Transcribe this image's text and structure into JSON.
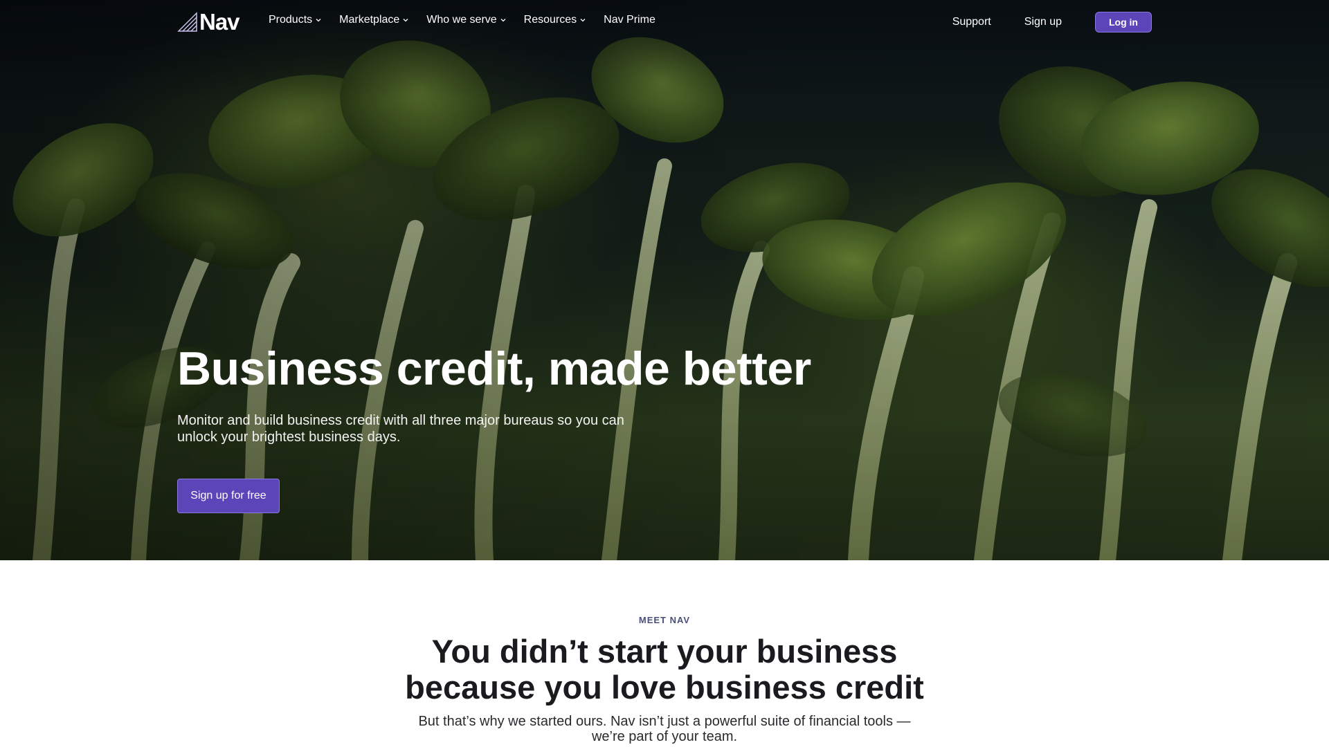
{
  "nav": {
    "logo_text": "Nav",
    "menu": [
      {
        "label": "Products",
        "has_dropdown": true
      },
      {
        "label": "Marketplace",
        "has_dropdown": true
      },
      {
        "label": "Who we serve",
        "has_dropdown": true
      },
      {
        "label": "Resources",
        "has_dropdown": true
      },
      {
        "label": "Nav Prime",
        "has_dropdown": false
      }
    ],
    "support_label": "Support",
    "signup_label": "Sign up",
    "login_label": "Log in"
  },
  "hero": {
    "title": "Business credit, made better",
    "subtitle_line1": "Monitor and build business credit with all three major bureaus so you can",
    "subtitle_line2": "unlock your brightest business days.",
    "cta_label": "Sign up for free",
    "background_image": "seedling-sprouts-photo"
  },
  "meet": {
    "eyebrow": "MEET NAV",
    "title_line1": "You didn’t start your business",
    "title_line2": "because you love business credit",
    "body_line1": "But that’s why we started ours. Nav isn’t just a powerful suite of financial tools —",
    "body_line2": "we’re part of your team."
  },
  "colors": {
    "accent": "#5b45b8",
    "accent_border": "#8c7ae0",
    "eyebrow": "#4a4f7a",
    "heading": "#1b1b1f"
  }
}
